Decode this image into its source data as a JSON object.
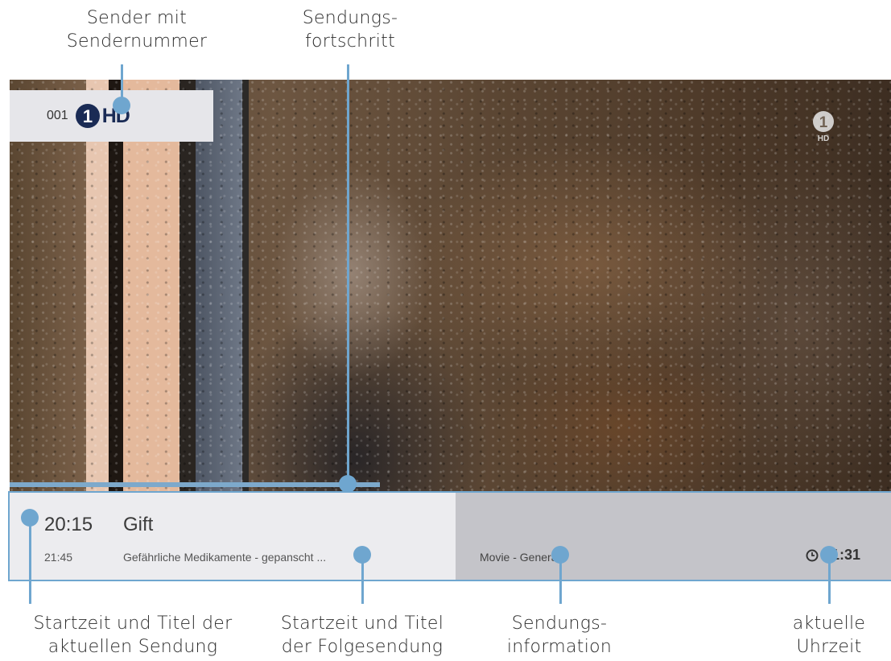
{
  "callouts": {
    "sender": [
      "Sender mit",
      "Sendernummer"
    ],
    "progress": [
      "Sendungs-",
      "fortschritt"
    ],
    "now": [
      "Startzeit und Titel der",
      "aktuellen Sendung"
    ],
    "next": [
      "Startzeit und Titel",
      "der Folgesendung"
    ],
    "info": [
      "Sendungs-",
      "information"
    ],
    "clock": [
      "aktuelle",
      "Uhrzeit"
    ]
  },
  "channel": {
    "number": "001",
    "logo_digit": "1",
    "hd_label": "HD"
  },
  "watermark": {
    "digit": "1",
    "hd": "HD"
  },
  "current_show": {
    "start_time": "20:15",
    "title": "Gift"
  },
  "next_show": {
    "start_time": "21:45",
    "title": "Gefährliche Medikamente - gepanscht ..."
  },
  "show_info": "Movie - General",
  "current_time": "21:31",
  "progress": {
    "percent": 0.42
  },
  "colors": {
    "accent": "#6fa6cf",
    "logo_blue": "#1a2b55",
    "bar_light": "#ececef",
    "bar_dark": "#c4c4c9"
  }
}
